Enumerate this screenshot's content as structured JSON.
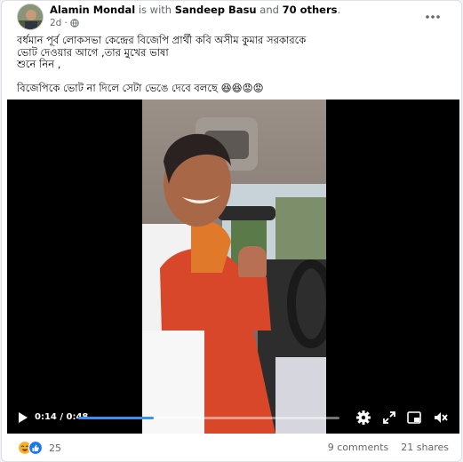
{
  "post": {
    "author": "Alamin Mondal",
    "with_word": "is with",
    "tagged": "Sandeep Basu",
    "and_word": "and",
    "others": "70 others",
    "others_suffix": ".",
    "time": "2d",
    "dot": "·",
    "privacy_icon": "globe-icon",
    "text_lines": [
      "বর্ধমান পূর্ব লোকসভা কেন্দ্রের বিজেপি প্রার্থী কবি অসীম কুমার সরকারকে",
      "ভোট দেওয়ার আগে ,তার মুখের ভাষা",
      "শুনে নিন ,",
      "বিজেপিকে ভোট না দিলে সেটা ভেঙে দেবে বলছে"
    ],
    "emojis": "😆😆😡😡"
  },
  "video": {
    "current_time": "0:14",
    "separator": " / ",
    "duration": "0:48",
    "progress": 0.29
  },
  "footer": {
    "reaction_count": "25",
    "comments": "9 comments",
    "shares": "21 shares"
  },
  "colors": {
    "progress": "#3a8ff3",
    "link_name": "#050505",
    "secondary": "#65676b"
  }
}
